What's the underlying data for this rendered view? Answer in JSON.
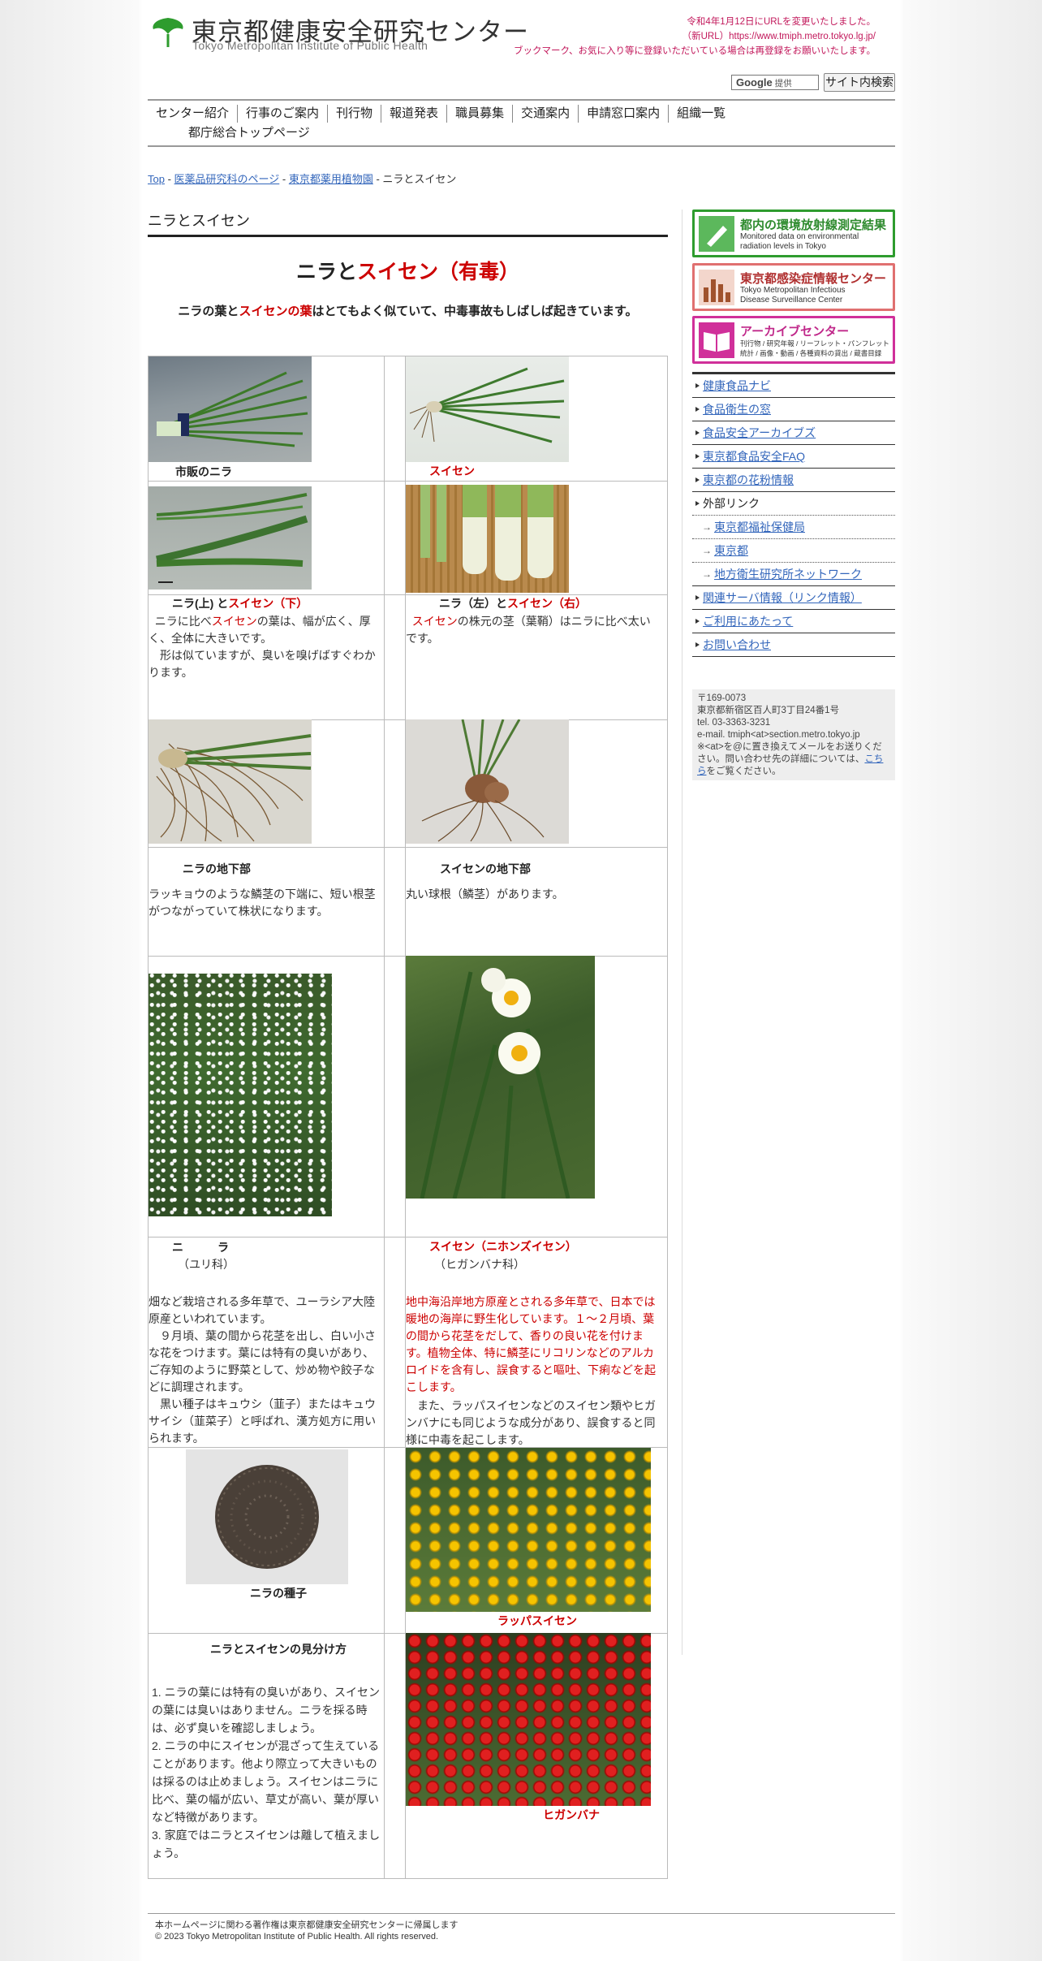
{
  "header": {
    "org_ja": "東京都健康安全研究センター",
    "org_en": "Tokyo Metropolitan Institute of Public Health",
    "notice_line1": "令和4年1月12日にURLを変更いたしました。",
    "notice_line2": "（新URL）https://www.tmiph.metro.tokyo.lg.jp/",
    "notice_line3": "ブックマーク、お気に入り等に登録いただいている場合は再登録をお願いいたします。",
    "search_provider": "Google",
    "search_provider_note": "提供",
    "search_button": "サイト内検索"
  },
  "nav": {
    "items": [
      "センター紹介",
      "行事のご案内",
      "刊行物",
      "報道発表",
      "職員募集",
      "交通案内",
      "申請窓口案内",
      "組織一覧"
    ],
    "second_line": "都庁総合トップページ"
  },
  "breadcrumb": {
    "top": "Top",
    "sep": " - ",
    "level1": "医薬品研究科のページ",
    "level2": "東京都薬用植物園",
    "current": "ニラとスイセン"
  },
  "main": {
    "section_title": "ニラとスイセン",
    "headline_a": "ニラと",
    "headline_b": "スイセン（有毒）",
    "lead_a": "ニラの葉と",
    "lead_b": "スイセンの葉",
    "lead_c": "はとてもよく似ていて、中毒事故もしばしば起きています。",
    "row1": {
      "left_caption": "市販のニラ",
      "right_caption": "スイセン"
    },
    "row2": {
      "left_caption_a": "ニラ(上) と",
      "left_caption_b": "スイセン（下）",
      "right_caption_a": "ニラ（左）と",
      "right_caption_b": "スイセン（右）",
      "left_text_a": "ニラに比べ",
      "left_text_b": "スイセン",
      "left_text_c": "の葉は、幅が広く、厚く、全体に大きいです。",
      "left_text_2": "形は似ていますが、臭いを嗅げばすぐわかります。",
      "right_text_a": "スイセン",
      "right_text_b": "の株元の茎（葉鞘）はニラに比べ太いです。"
    },
    "row3": {
      "left_caption": "ニラの地下部",
      "right_caption": "スイセンの地下部",
      "left_text": "ラッキョウのような鱗茎の下端に、短い根茎がつながっていて株状になります。",
      "right_text": "丸い球根（鱗茎）があります。"
    },
    "row4": {
      "left_name": "ニ　　　ラ",
      "left_family": "（ユリ科）",
      "right_name": "スイセン（ニホンズイセン）",
      "right_family": "（ヒガンバナ科）",
      "left_text_1": "畑など栽培される多年草で、ユーラシア大陸原産といわれています。",
      "left_text_2": "９月頃、葉の間から花茎を出し、白い小さな花をつけます。葉には特有の臭いがあり、ご存知のように野菜として、炒め物や餃子などに調理されます。",
      "left_text_3": "黒い種子はキュウシ（韮子）またはキュウサイシ（韮菜子）と呼ばれ、漢方処方に用いられます。",
      "right_text_1": "地中海沿岸地方原産とされる多年草で、日本では暖地の海岸に野生化しています。１〜２月頃、葉の間から花茎をだして、香りの良い花を付けます。植物全体、特に鱗茎にリコリンなどのアルカロイドを含有し、誤食すると嘔吐、下痢などを起こします。",
      "right_text_2": "また、ラッパスイセンなどのスイセン類やヒガンバナにも同じような成分があり、誤食すると同様に中毒を起こします。"
    },
    "row5": {
      "left_caption": "ニラの種子",
      "right_caption": "ラッパスイセン"
    },
    "row6": {
      "left_title": "ニラとスイセンの見分け方",
      "tip1": "1. ニラの葉には特有の臭いがあり、スイセンの葉には臭いはありません。ニラを採る時は、必ず臭いを確認しましょう。",
      "tip2": "2. ニラの中にスイセンが混ざって生えていることがあります。他より際立って大きいものは採るのは止めましょう。スイセンはニラに比べ、葉の幅が広い、草丈が高い、葉が厚いなど特徴があります。",
      "tip3": "3. 家庭ではニラとスイセンは離して植えましょう。",
      "right_caption": "ヒガンバナ"
    }
  },
  "sidebar": {
    "banner1_title": "都内の環境放射線測定結果",
    "banner1_sub1": "Monitored data on environmental",
    "banner1_sub2": "radiation levels in Tokyo",
    "banner2_title": "東京都感染症情報センター",
    "banner2_sub1": "Tokyo Metropolitan Infectious",
    "banner2_sub2": "Disease Surveillance Center",
    "banner3_title": "アーカイブセンター",
    "banner3_sub1": "刊行物 / 研究年報 / リーフレット・パンフレット",
    "banner3_sub2": "統計 / 画像・動画 / 各種資料の貸出 / 蔵書目録",
    "links": [
      "健康食品ナビ",
      "食品衛生の窓",
      "食品安全アーカイブズ",
      "東京都食品安全FAQ",
      "東京都の花粉情報"
    ],
    "external_label": "外部リンク",
    "external": [
      "東京都福祉保健局",
      "東京都",
      "地方衛生研究所ネットワーク"
    ],
    "bottom_links": [
      "関連サーバ情報（リンク情報）",
      "ご利用にあたって",
      "お問い合わせ"
    ],
    "address": {
      "postal": "〒169-0073",
      "street": "東京都新宿区百人町3丁目24番1号",
      "tel": "tel. 03-3363-3231",
      "email": "e-mail. tmiph<at>section.metro.tokyo.jp",
      "note_a": "※<at>を@に置き換えてメールをお送りください。問い合わせ先の詳細については、",
      "note_link": "こちら",
      "note_b": "をご覧ください。"
    }
  },
  "footer": {
    "line1": "本ホームページに関わる著作権は東京都健康安全研究センターに帰属します",
    "line2": "© 2023 Tokyo Metropolitan Institute of Public Health. All rights reserved."
  },
  "colors": {
    "accent_red": "#cc0000",
    "link": "#3366bb",
    "notice": "#c2185b",
    "logo_green": "#2e9c2e"
  }
}
